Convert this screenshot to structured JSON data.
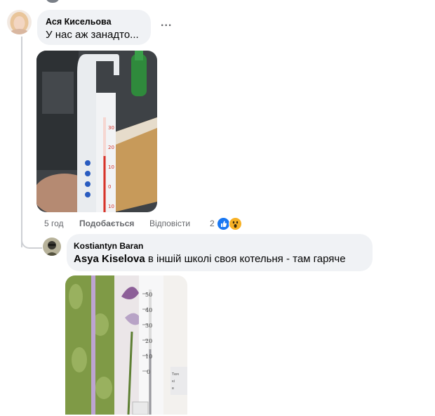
{
  "comment": {
    "author": "Ася Кисельова",
    "text": "У нас аж занадто...",
    "more_label": "...",
    "time": "5 год",
    "like_label": "Подобається",
    "reply_label": "Відповісти",
    "reaction_count": "2",
    "reactions": [
      "like-icon",
      "wow-icon"
    ],
    "colors": {
      "like": "#1877f2",
      "wow": "#f7b125"
    }
  },
  "reply": {
    "author": "Kostiantyn Baran",
    "mention": "Asya Kiselova",
    "text": " в іншій школі своя котельня - там гаряче"
  }
}
